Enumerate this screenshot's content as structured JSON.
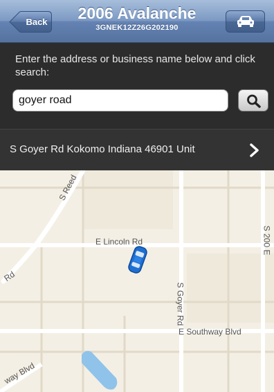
{
  "nav": {
    "back_label": "Back",
    "title": "2006 Avalanche",
    "subtitle": "3GNEK12Z26G202190"
  },
  "search": {
    "instruction": "Enter the address or business name below and click search:",
    "query": "goyer road"
  },
  "result": {
    "text": "S Goyer Rd Kokomo Indiana 46901 Unit"
  },
  "map": {
    "labels": {
      "reed": "S Reed",
      "lincoln": "E Lincoln Rd",
      "rd_left": "Rd",
      "s200e": "S 200 E",
      "goyer": "S Goyer Rd",
      "southway": "E Southway Blvd",
      "way_blvd": "way Blvd"
    }
  },
  "colors": {
    "nav_blue": "#6f8cba",
    "panel_dark": "#2c2c2c",
    "map_bg": "#f4efe4",
    "road": "#ffffff",
    "water": "#8fc3ea",
    "marker": "#1f6fd1"
  },
  "icons": [
    "back-arrow-icon",
    "car-icon",
    "search-icon",
    "chevron-right-icon",
    "car-location-marker-icon"
  ]
}
